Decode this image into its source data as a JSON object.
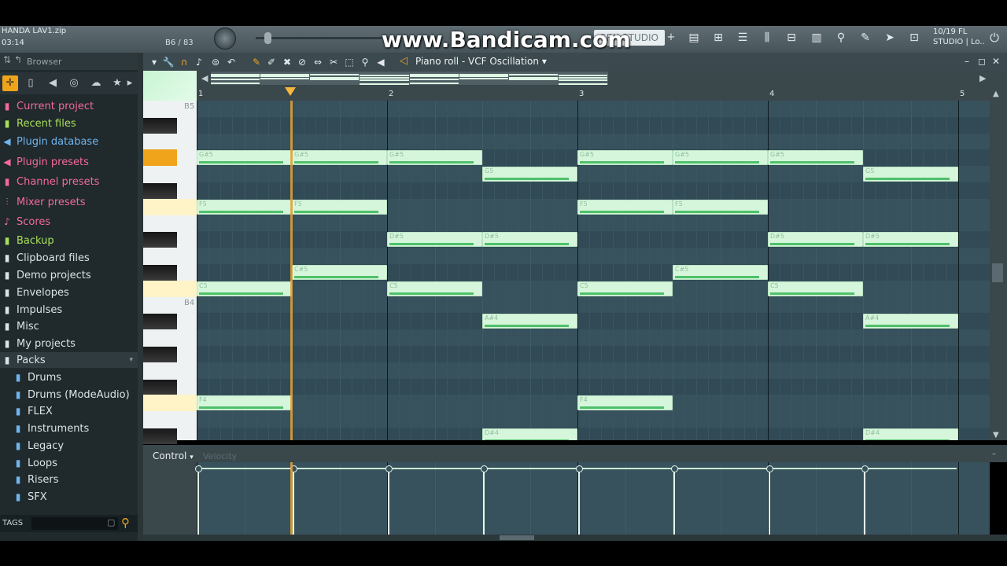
{
  "top": {
    "hint_line1": "HANDA LAV1.zip",
    "hint_line2": "03:14",
    "pattern_count": "B6 / 83",
    "watermark": "www.Bandicam.com",
    "studio_label": "SRX STUDIO",
    "news_line1": "10/19  FL",
    "news_line2": "STUDIO | Lo.."
  },
  "browser": {
    "title": "Browser",
    "items": [
      {
        "label": "Current project",
        "icon": "folder-icon",
        "color": "pink"
      },
      {
        "label": "Recent files",
        "icon": "folder-icon",
        "color": "green"
      },
      {
        "label": "Plugin database",
        "icon": "plug-icon",
        "color": "blue"
      },
      {
        "label": "Plugin presets",
        "icon": "plug-icon",
        "color": "pink"
      },
      {
        "label": "Channel presets",
        "icon": "folder-icon",
        "color": "pink"
      },
      {
        "label": "Mixer presets",
        "icon": "mixer-icon",
        "color": "pink"
      },
      {
        "label": "Scores",
        "icon": "note-icon",
        "color": "pink"
      },
      {
        "label": "Backup",
        "icon": "folder-icon",
        "color": "green"
      },
      {
        "label": "Clipboard files",
        "icon": "folder-icon",
        "color": "white"
      },
      {
        "label": "Demo projects",
        "icon": "folder-icon",
        "color": "white"
      },
      {
        "label": "Envelopes",
        "icon": "folder-icon",
        "color": "white"
      },
      {
        "label": "Impulses",
        "icon": "folder-icon",
        "color": "white"
      },
      {
        "label": "Misc",
        "icon": "folder-icon",
        "color": "white"
      },
      {
        "label": "My projects",
        "icon": "folder-icon",
        "color": "white"
      },
      {
        "label": "Packs",
        "icon": "folder-icon",
        "color": "white"
      }
    ],
    "packs": [
      "Drums",
      "Drums (ModeAudio)",
      "FLEX",
      "Instruments",
      "Legacy",
      "Loops",
      "Risers",
      "SFX"
    ],
    "tags_label": "TAGS"
  },
  "piano_roll": {
    "title": "Piano roll - VCF Oscillation",
    "bars": [
      "1",
      "2",
      "3",
      "4",
      "5"
    ],
    "octave_labels": {
      "top": "B5",
      "mid": "B4"
    },
    "control_label": "Control",
    "control_target": "Velocity",
    "notes": [
      {
        "pitch": "G#5",
        "start": 0,
        "len": 1
      },
      {
        "pitch": "G#5",
        "start": 1,
        "len": 1
      },
      {
        "pitch": "G#5",
        "start": 2,
        "len": 1
      },
      {
        "pitch": "G5",
        "start": 3,
        "len": 1
      },
      {
        "pitch": "G#5",
        "start": 4,
        "len": 1
      },
      {
        "pitch": "G#5",
        "start": 5,
        "len": 1
      },
      {
        "pitch": "G#5",
        "start": 6,
        "len": 1
      },
      {
        "pitch": "G5",
        "start": 7,
        "len": 1
      },
      {
        "pitch": "F5",
        "start": 0,
        "len": 1
      },
      {
        "pitch": "F5",
        "start": 1,
        "len": 1
      },
      {
        "pitch": "F5",
        "start": 4,
        "len": 1
      },
      {
        "pitch": "F5",
        "start": 5,
        "len": 1
      },
      {
        "pitch": "D#5",
        "start": 2,
        "len": 1
      },
      {
        "pitch": "D#5",
        "start": 3,
        "len": 1
      },
      {
        "pitch": "D#5",
        "start": 6,
        "len": 1
      },
      {
        "pitch": "D#5",
        "start": 7,
        "len": 1
      },
      {
        "pitch": "C#5",
        "start": 1,
        "len": 1
      },
      {
        "pitch": "C#5",
        "start": 5,
        "len": 1
      },
      {
        "pitch": "C5",
        "start": 0,
        "len": 1
      },
      {
        "pitch": "C5",
        "start": 2,
        "len": 1
      },
      {
        "pitch": "C5",
        "start": 4,
        "len": 1
      },
      {
        "pitch": "C5",
        "start": 6,
        "len": 1
      },
      {
        "pitch": "A#4",
        "start": 3,
        "len": 1
      },
      {
        "pitch": "A#4",
        "start": 7,
        "len": 1
      },
      {
        "pitch": "F4",
        "start": 0,
        "len": 1
      },
      {
        "pitch": "F4",
        "start": 4,
        "len": 1
      },
      {
        "pitch": "D#4",
        "start": 3,
        "len": 1
      },
      {
        "pitch": "D#4",
        "start": 7,
        "len": 1
      }
    ],
    "velocity_positions": [
      0,
      1,
      2,
      3,
      4,
      5,
      6,
      7
    ]
  },
  "colors": {
    "accent": "#f0a41c",
    "grid": "#37525d",
    "note": "#d6f6dc",
    "velocity": "#4fc06a"
  }
}
